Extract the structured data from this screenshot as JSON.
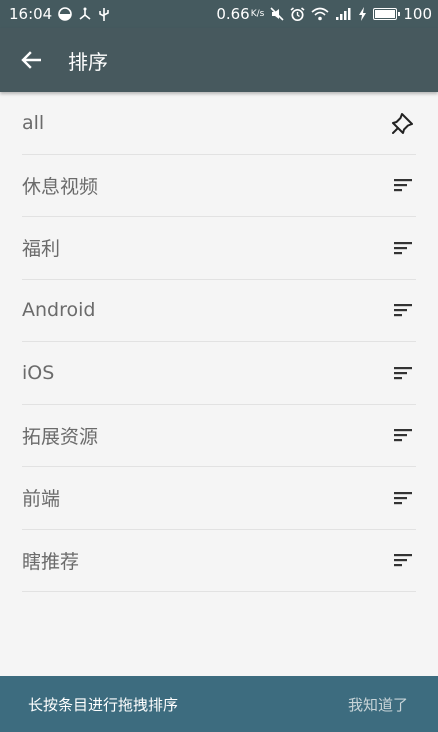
{
  "status_bar": {
    "time": "16:04",
    "network_speed": "0.66",
    "network_unit": "K/s",
    "battery_level": "100",
    "battery_fraction": 1.0,
    "icons": [
      "half-circle-icon",
      "usb-share-icon",
      "usb-icon",
      "mute-icon",
      "alarm-icon",
      "wifi-icon",
      "signal-icon",
      "charging-icon",
      "battery-icon"
    ]
  },
  "app_bar": {
    "title": "排序",
    "back_icon": "arrow-left-icon",
    "color": "#47595e"
  },
  "list": {
    "items": [
      {
        "label": "all",
        "icon": "pin-icon"
      },
      {
        "label": "休息视频",
        "icon": "sort-handle-icon"
      },
      {
        "label": "福利",
        "icon": "sort-handle-icon"
      },
      {
        "label": "Android",
        "icon": "sort-handle-icon"
      },
      {
        "label": "iOS",
        "icon": "sort-handle-icon"
      },
      {
        "label": "拓展资源",
        "icon": "sort-handle-icon"
      },
      {
        "label": "前端",
        "icon": "sort-handle-icon"
      },
      {
        "label": "瞎推荐",
        "icon": "sort-handle-icon"
      }
    ]
  },
  "bottom_bar": {
    "hint": "长按条目进行拖拽排序",
    "dismiss_label": "我知道了",
    "color": "#3d6c7f"
  }
}
